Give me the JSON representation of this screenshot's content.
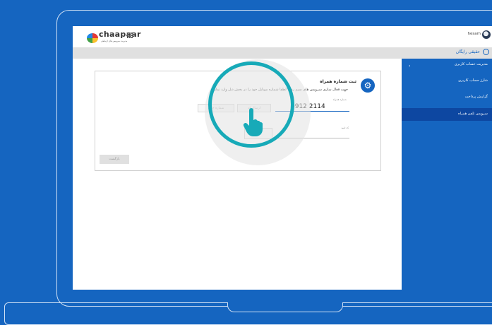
{
  "header": {
    "logo_text": "chaapaar",
    "logo_subtext": "مدیریت سرویس های ارتباطی",
    "username": "hesam",
    "account_type": "حقیقی رایگان"
  },
  "sidebar": {
    "items": [
      {
        "label": "مدیریت حساب کاربری",
        "expand_icon": "‹"
      },
      {
        "label": "شارژ حساب کاربری"
      },
      {
        "label": "گزارش پرداخت"
      },
      {
        "label": "سرویس تلفن همراه"
      }
    ]
  },
  "form": {
    "title": "ثبت شماره همراه",
    "description": "جهت فعال سازی سرویس های سیم ری ، لطفا شماره موبایل خود را در بخش ذیل وارد نمایید",
    "phone_label": "شماره همراه",
    "phone_value": "0912 2114",
    "send_code_label": "ارسال کد",
    "new_number_label": "شماره جدید",
    "code_label": "کد تایید",
    "back_label": "بازگشت"
  },
  "colors": {
    "background": "#1565c0",
    "sidebar": "#1565c0",
    "sidebar_active": "#0d47a1",
    "accent_ring": "#17aab8"
  },
  "icons": {
    "apps": "apps-grid-icon",
    "gear": "gear-icon",
    "pointer": "hand-pointer-icon",
    "account": "account-circle-icon"
  }
}
